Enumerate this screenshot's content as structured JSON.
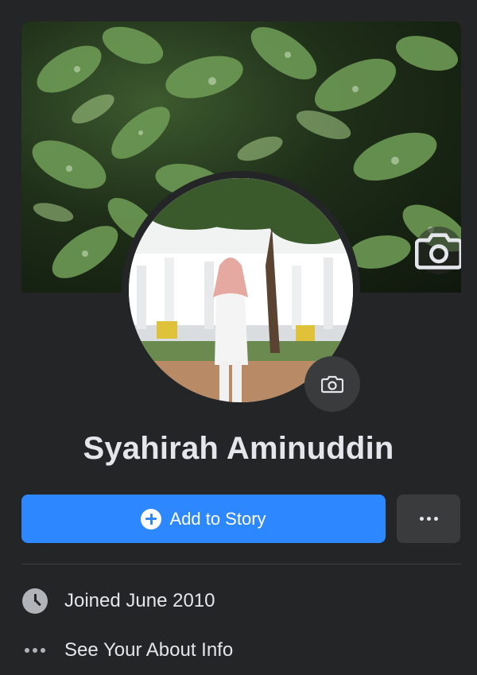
{
  "profile": {
    "name": "Syahirah Aminuddin"
  },
  "actions": {
    "add_story_label": "Add to Story",
    "more_icon": "ellipsis-icon"
  },
  "info": {
    "joined": "Joined June 2010",
    "about_link": "See Your About Info"
  },
  "icons": {
    "cover_camera": "camera-icon",
    "avatar_camera": "camera-icon",
    "joined": "clock-icon",
    "about": "ellipsis-icon"
  },
  "colors": {
    "background": "#242526",
    "primary_button": "#2d88ff",
    "secondary_button": "#3a3b3c",
    "text": "#e4e6eb",
    "icon_gray": "#b0b3b8"
  }
}
